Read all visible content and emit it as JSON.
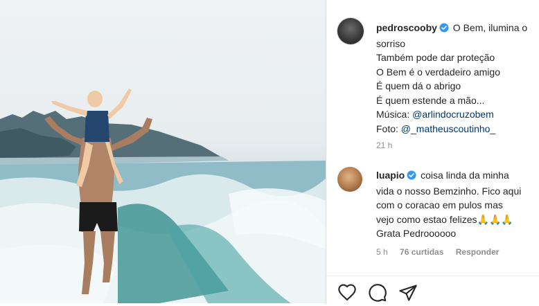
{
  "post": {
    "author": "pedroscooby",
    "caption_first": "O Bem, ilumina o",
    "caption_lines": [
      "sorriso",
      "Também pode dar proteção",
      "O Bem é o verdadeiro amigo",
      "É quem dá o abrigo",
      "É quem estende a mão..."
    ],
    "music_label": "Música:",
    "music_handle": "@arlindocruzobem",
    "photo_label": "Foto:",
    "photo_handle": "@_matheuscoutinho_",
    "time": "21 h"
  },
  "comment": {
    "author": "luapio",
    "text_first": "coisa linda da minha",
    "text_lines": [
      "vida o nosso Bemzinho. Fico aqui",
      "com o coracao em pulos mas",
      "vejo como estao felizes🙏🙏🙏",
      "Grata Pedroooooo"
    ],
    "time": "5 h",
    "likes": "76 curtidas",
    "reply": "Responder"
  },
  "icons": {
    "like": "heart-icon",
    "comment": "comment-icon",
    "share": "paper-plane-icon",
    "verified": "verified-badge-icon"
  },
  "colors": {
    "verified": "#3897f0",
    "link": "#00376b",
    "muted": "#8e8e8e"
  }
}
